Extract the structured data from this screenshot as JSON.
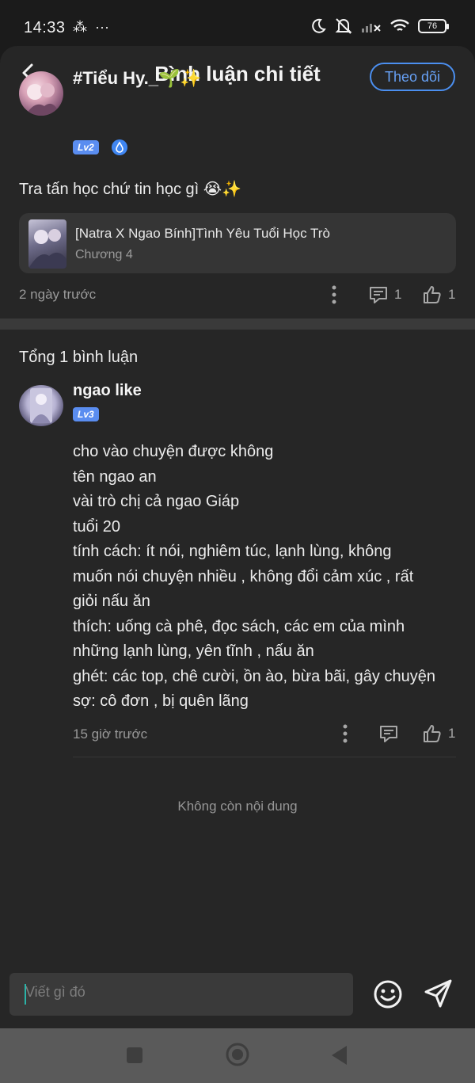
{
  "status_bar": {
    "time": "14:33",
    "battery": "76"
  },
  "header": {
    "title": "Bình luận chi tiết"
  },
  "post": {
    "username": "#Tiểu Hy._🌱✨",
    "level": "Lv2",
    "follow_label": "Theo dõi",
    "text": "Tra tấn học chứ tin học gì 😭✨",
    "story": {
      "title": "[Natra X Ngao Bính]Tình Yêu Tuổi Học Trò",
      "chapter": "Chương 4"
    },
    "time": "2 ngày trước",
    "reply_count": "1",
    "like_count": "1"
  },
  "comments": {
    "total_label": "Tổng 1 bình luận",
    "items": [
      {
        "username": "ngao like",
        "level": "Lv3",
        "lines": [
          "cho vào chuyện được không",
          "tên ngao an",
          "vài trò chị cả ngao Giáp",
          "tuổi 20",
          "tính cách: ít nói, nghiêm túc, lạnh lùng, không",
          "muốn nói chuyện nhiều , không đổi cảm xúc , rất",
          "giỏi nấu ăn",
          "thích: uống cà phê, đọc sách, các em của mình",
          "những lạnh lùng, yên tĩnh , nấu ăn",
          "ghét: các top, chê cười, ồn ào, bừa bãi, gây chuyện",
          "sợ: cô đơn , bị quên lãng"
        ],
        "time": "15 giờ trước",
        "like_count": "1"
      }
    ],
    "end_label": "Không còn nội dung"
  },
  "input": {
    "placeholder": "Viết gì đó"
  },
  "colors": {
    "accent": "#5a8df0",
    "background": "#262626"
  },
  "icons": [
    "back-icon",
    "more-icon",
    "comment-icon",
    "like-icon",
    "emoji-icon",
    "send-icon",
    "nav-recents-icon",
    "nav-home-icon",
    "nav-back-icon"
  ]
}
